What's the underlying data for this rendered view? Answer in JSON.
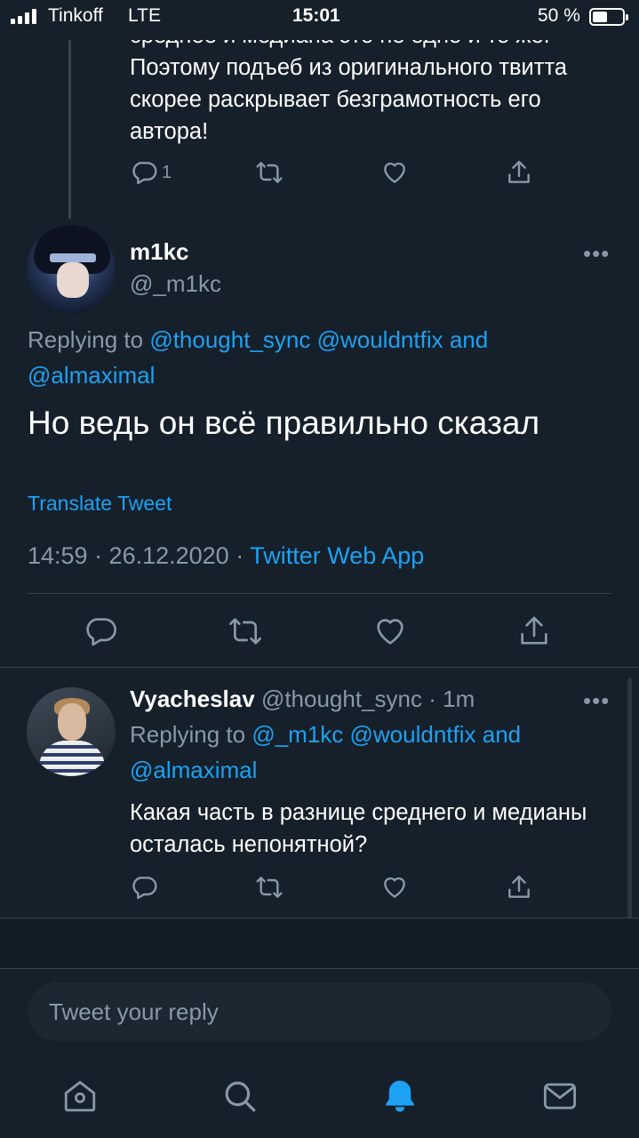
{
  "status_bar": {
    "carrier": "Tinkoff",
    "network": "LTE",
    "time": "15:01",
    "battery_percent": "50 %",
    "battery_level": 0.5
  },
  "previous_tweet": {
    "text": "среднее и медиана это не одно и то же. Поэтому подъеб из оригинального твитта скорее раскрывает безграмотность его автора!",
    "reply_count": "1",
    "icons": [
      "reply-icon",
      "retweet-icon",
      "like-icon",
      "share-icon"
    ]
  },
  "main_tweet": {
    "display_name": "m1kc",
    "handle": "@_m1kc",
    "more": "•••",
    "replying_prefix": "Replying to",
    "replying_users": "@thought_sync @wouldntfix and @almaximal",
    "text": "Но ведь он всё правильно сказал",
    "translate": "Translate Tweet",
    "timestamp": "14:59 · 26.12.2020 ·",
    "source": "Twitter Web App"
  },
  "reply_tweet": {
    "display_name": "Vyacheslav",
    "handle": "@thought_sync",
    "age": "· 1m",
    "more": "•••",
    "replying_prefix": "Replying to",
    "replying_users": "@_m1kc @wouldntfix and @almaximal",
    "text": "Какая часть в разнице среднего и медианы осталась непонятной?"
  },
  "composer": {
    "placeholder": "Tweet your reply"
  },
  "tab_bar": {
    "items": [
      "home-icon",
      "search-icon",
      "notifications-icon",
      "messages-icon"
    ],
    "active": "notifications-icon",
    "colors": {
      "active": "#1da1f2",
      "inactive": "#8899a6"
    }
  },
  "colors": {
    "background": "#15202b",
    "link": "#1da1f2",
    "muted": "#8899a6"
  }
}
